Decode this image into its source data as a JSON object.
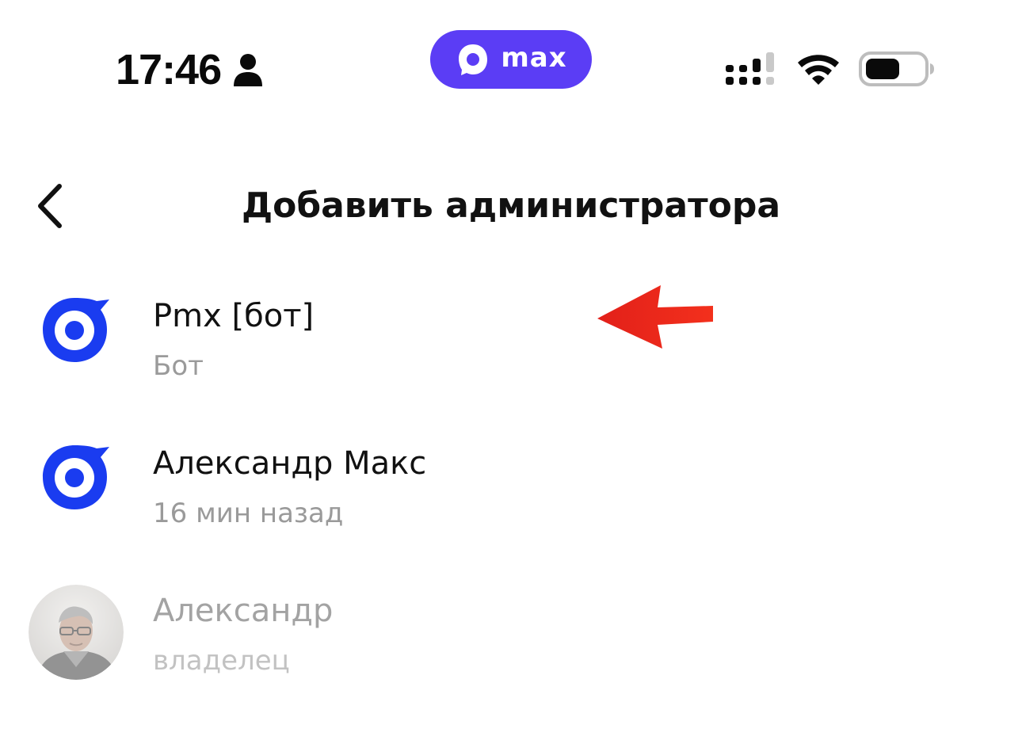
{
  "status_bar": {
    "time": "17:46",
    "app_pill_label": "max",
    "app_pill_color": "#5b3df5",
    "person_icon": "person-icon",
    "signal_icon": "cellular-signal-icon",
    "wifi_icon": "wifi-icon",
    "battery_icon": "battery-icon"
  },
  "header": {
    "back_icon": "chevron-left-icon",
    "title": "Добавить администратора"
  },
  "members": [
    {
      "name": "Pmx [бот]",
      "subtitle": "Бот",
      "avatar": "max-logo-icon",
      "avatar_color": "#1a3cf0"
    },
    {
      "name": "Александр Макс",
      "subtitle": "16 мин назад",
      "avatar": "max-logo-icon",
      "avatar_color": "#1a3cf0"
    },
    {
      "name": "Александр",
      "subtitle": "владелец",
      "avatar": "user-photo"
    }
  ],
  "annotation": {
    "arrow_color": "#f0291a",
    "arrow_icon": "red-arrow-left-icon"
  }
}
